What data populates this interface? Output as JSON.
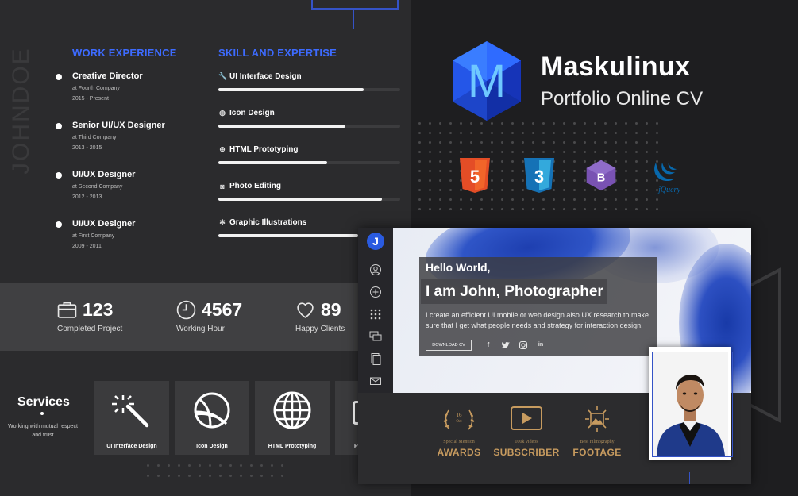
{
  "resume": {
    "name_vertical": "JOHNDOE",
    "work_title": "WORK EXPERIENCE",
    "skill_title": "SKILL AND EXPERTISE",
    "jobs": [
      {
        "role": "Creative Director",
        "company": "at Fourth Company",
        "years": "2015 - Present"
      },
      {
        "role": "Senior UI/UX Designer",
        "company": "at Third Company",
        "years": "2013 - 2015"
      },
      {
        "role": "UI/UX Designer",
        "company": "at Second Company",
        "years": "2012 - 2013"
      },
      {
        "role": "UI/UX Designer",
        "company": "at First Company",
        "years": "2009 - 2011"
      }
    ],
    "skills": [
      {
        "label": "UI Interface Design",
        "icon": "wrench-icon",
        "level": 0.8
      },
      {
        "label": "Icon Design",
        "icon": "globe-icon",
        "level": 0.7
      },
      {
        "label": "HTML Prototyping",
        "icon": "grid-globe-icon",
        "level": 0.6
      },
      {
        "label": "Photo Editing",
        "icon": "camera-icon",
        "level": 0.9
      },
      {
        "label": "Graphic Illustrations",
        "icon": "snowflake-icon",
        "level": 0.77
      }
    ],
    "stats": [
      {
        "value": "123",
        "caption": "Completed Project",
        "icon": "briefcase-icon"
      },
      {
        "value": "4567",
        "caption": "Working Hour",
        "icon": "clock-icon"
      },
      {
        "value": "89",
        "caption": "Happy Clients",
        "icon": "heart-icon"
      }
    ],
    "services": {
      "title": "Services",
      "subtitle": "Working with mutual respect and trust",
      "items": [
        {
          "label": "UI Interface Design",
          "icon": "magic-wand-icon"
        },
        {
          "label": "Icon Design",
          "icon": "basketball-icon"
        },
        {
          "label": "HTML Prototyping",
          "icon": "globe-icon"
        },
        {
          "label": "P",
          "icon": "partial-icon"
        }
      ]
    }
  },
  "brand": {
    "logo_letter": "M",
    "title": "Maskulinux",
    "subtitle": "Portfolio Online CV",
    "tech": [
      "html5-icon",
      "css3-icon",
      "bootstrap-icon",
      "jquery-icon"
    ],
    "html5_digit": "5",
    "css3_digit": "3",
    "bootstrap_letter": "B",
    "jquery_text": "jQuery"
  },
  "mockup": {
    "logo_letter": "J",
    "nav_icons": [
      "user-icon",
      "plus-circle-icon",
      "apps-icon",
      "chat-icon",
      "document-icon",
      "mail-icon"
    ],
    "hello": "Hello World,",
    "headline": "I am John, Photographer",
    "description": "I create an efficient UI mobile or web design also UX research to make sure that I get what people needs and strategy for interaction design.",
    "download_label": "DOWNLOAD CV",
    "socials": [
      "facebook-icon",
      "twitter-icon",
      "instagram-icon",
      "linkedin-icon"
    ],
    "social_glyphs": {
      "facebook": "f",
      "linkedin": "in"
    },
    "awards": [
      {
        "icon": "laurel-icon",
        "badge_num": "16",
        "badge_text": "Oct",
        "sub": "Special Mention",
        "title": "AWARDS"
      },
      {
        "icon": "play-icon",
        "sub": "100k videos",
        "title": "SUBSCRIBER"
      },
      {
        "icon": "photo-icon",
        "sub": "Best Filmography",
        "title": "FOOTAGE"
      }
    ],
    "accent": "#c79b5f"
  },
  "colors": {
    "accent_blue": "#3d6bff",
    "panel": "#2b2b2d",
    "stats_bg": "#404042"
  }
}
